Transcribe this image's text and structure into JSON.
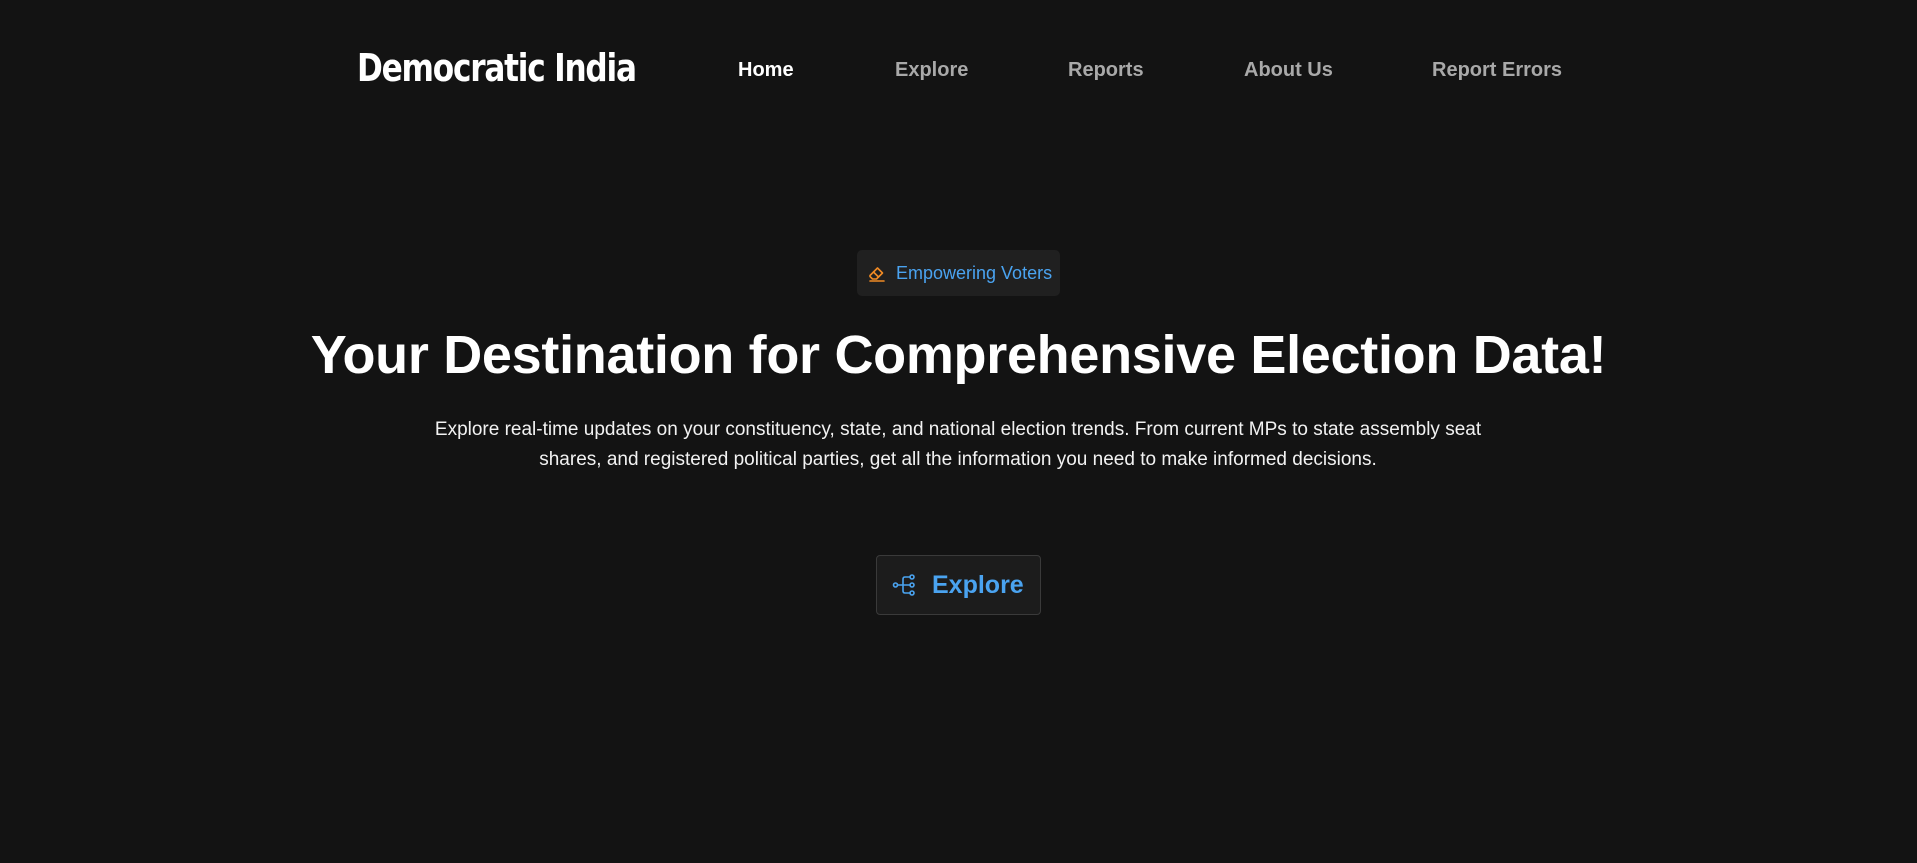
{
  "header": {
    "brand": "Democratic India",
    "nav": [
      {
        "label": "Home",
        "active": true
      },
      {
        "label": "Explore",
        "active": false
      },
      {
        "label": "Reports",
        "active": false
      },
      {
        "label": "About Us",
        "active": false
      },
      {
        "label": "Report Errors",
        "active": false
      }
    ]
  },
  "hero": {
    "badge": {
      "icon": "eraser-vote-icon",
      "label": "Empowering Voters"
    },
    "title": "Your Destination for Comprehensive Election Data!",
    "description": "Explore real-time updates on your constituency, state, and national election trends. From current MPs to state assembly seat shares, and registered political parties, get all the information you need to make informed decisions.",
    "cta": {
      "icon": "hierarchy-icon",
      "label": "Explore"
    }
  },
  "colors": {
    "background": "#131313",
    "accent": "#4aa3f0",
    "badge_icon": "#f08a24",
    "nav_inactive": "#a9a9a9"
  }
}
